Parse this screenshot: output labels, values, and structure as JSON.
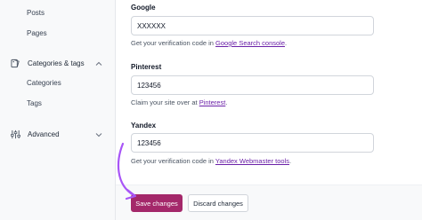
{
  "sidebar": {
    "sub_items_top": [
      {
        "label": "Posts"
      },
      {
        "label": "Pages"
      }
    ],
    "group_taxonomies": {
      "label": "Categories & tags",
      "icon": "tag-icon"
    },
    "sub_items_taxonomies": [
      {
        "label": "Categories"
      },
      {
        "label": "Tags"
      }
    ],
    "group_advanced": {
      "label": "Advanced",
      "icon": "sliders-icon"
    }
  },
  "fields": {
    "google": {
      "label": "Google",
      "value": "XXXXXX",
      "help_prefix": "Get your verification code in ",
      "help_link": "Google Search console",
      "help_suffix": "."
    },
    "pinterest": {
      "label": "Pinterest",
      "value": "123456",
      "help_prefix": "Claim your site over at ",
      "help_link": "Pinterest",
      "help_suffix": "."
    },
    "yandex": {
      "label": "Yandex",
      "value": "123456",
      "help_prefix": "Get your verification code in ",
      "help_link": "Yandex Webmaster tools",
      "help_suffix": "."
    }
  },
  "footer": {
    "save_label": "Save changes",
    "discard_label": "Discard changes"
  },
  "colors": {
    "primary": "#a4286a",
    "arrow": "#a855f7",
    "link": "#6b21a8"
  }
}
